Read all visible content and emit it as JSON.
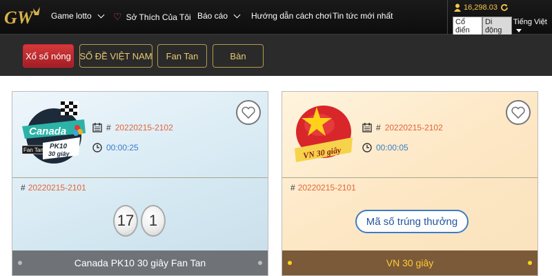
{
  "header": {
    "logo_text": "GW",
    "nav": [
      {
        "label": "Game lotto",
        "dropdown": true
      },
      {
        "label": "Sở Thích Của Tôi",
        "dropdown": false
      },
      {
        "label": "Báo cáo",
        "dropdown": true
      },
      {
        "label": "Hướng dẫn cách chơi",
        "dropdown": false
      },
      {
        "label": "Tin tức mới nhất",
        "dropdown": false
      }
    ],
    "balance": "16,298.03",
    "mode_classic": "Cổ điển",
    "mode_mobile": "Di động",
    "language": "Tiếng Việt"
  },
  "categories": [
    {
      "label": "Xổ số nóng",
      "active": true
    },
    {
      "label": "SỐ ĐỀ VIỆT NAM",
      "active": false
    },
    {
      "label": "Fan Tan",
      "active": false
    },
    {
      "label": "Bàn",
      "active": false
    }
  ],
  "cards": [
    {
      "logo_title": "Canada",
      "logo_sub1": "PK10",
      "logo_sub2": "30 giây",
      "logo_tag": "Fan Tan",
      "hash": "#",
      "current_period": "20220215-2102",
      "countdown": "00:00:25",
      "prev_period": "20220215-2101",
      "result_balls": [
        "17",
        "1"
      ],
      "name": "Canada PK10 30 giây Fan Tan"
    },
    {
      "logo_title": "VN 30 giây",
      "hash": "#",
      "current_period": "20220215-2102",
      "countdown": "00:00:05",
      "prev_period": "20220215-2101",
      "win_button": "Mã số trúng thưởng",
      "name": "VN 30 giây"
    }
  ],
  "colors": {
    "accent_gold": "#e8c870",
    "hot_red": "#c52a2e",
    "period_orange": "#e2653a",
    "timer_blue": "#3a7ec4"
  }
}
